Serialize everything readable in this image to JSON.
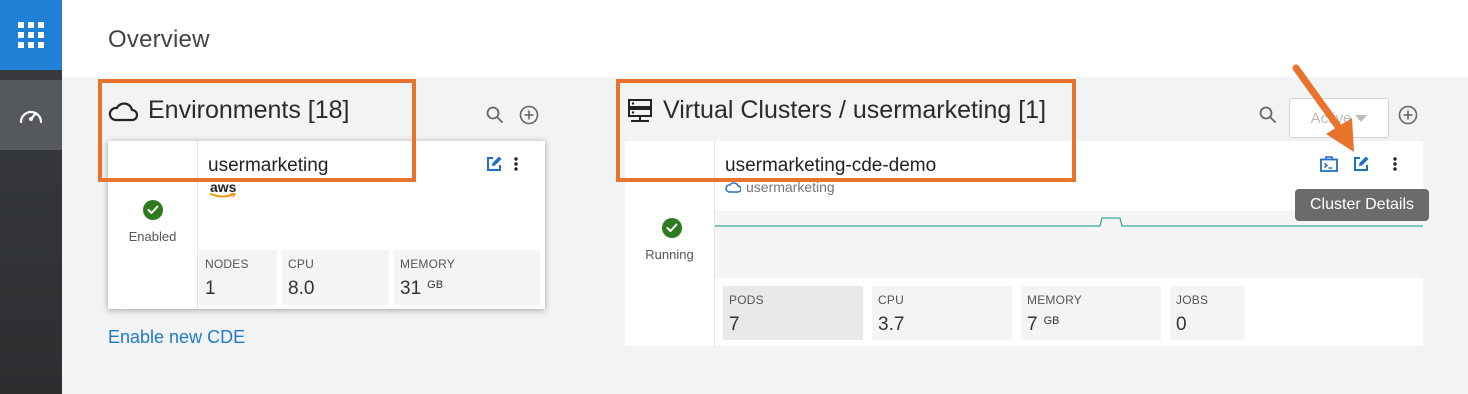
{
  "header": {
    "title": "Overview"
  },
  "environments": {
    "title": "Environments [18]",
    "card": {
      "name": "usermarketing",
      "provider": "aws",
      "status": "Enabled",
      "stats": [
        {
          "label": "NODES",
          "value": "1",
          "unit": ""
        },
        {
          "label": "CPU",
          "value": "8.0",
          "unit": ""
        },
        {
          "label": "MEMORY",
          "value": "31",
          "unit": "GB"
        }
      ]
    },
    "enable_link": "Enable new CDE"
  },
  "virtual_clusters": {
    "title": "Virtual Clusters / usermarketing [1]",
    "filter": {
      "selected": "Active"
    },
    "card": {
      "name": "usermarketing-cde-demo",
      "environment": "usermarketing",
      "status": "Running",
      "stats": [
        {
          "label": "PODS",
          "value": "7",
          "unit": ""
        },
        {
          "label": "CPU",
          "value": "3.7",
          "unit": ""
        },
        {
          "label": "MEMORY",
          "value": "7",
          "unit": "GB"
        },
        {
          "label": "JOBS",
          "value": "0",
          "unit": ""
        }
      ]
    },
    "tooltip": "Cluster Details"
  },
  "colors": {
    "accent": "#1f80d6",
    "annotation": "#e8732c",
    "success": "#2d7a1f",
    "link": "#1f7ac8",
    "graph_line": "#3aa89a"
  }
}
